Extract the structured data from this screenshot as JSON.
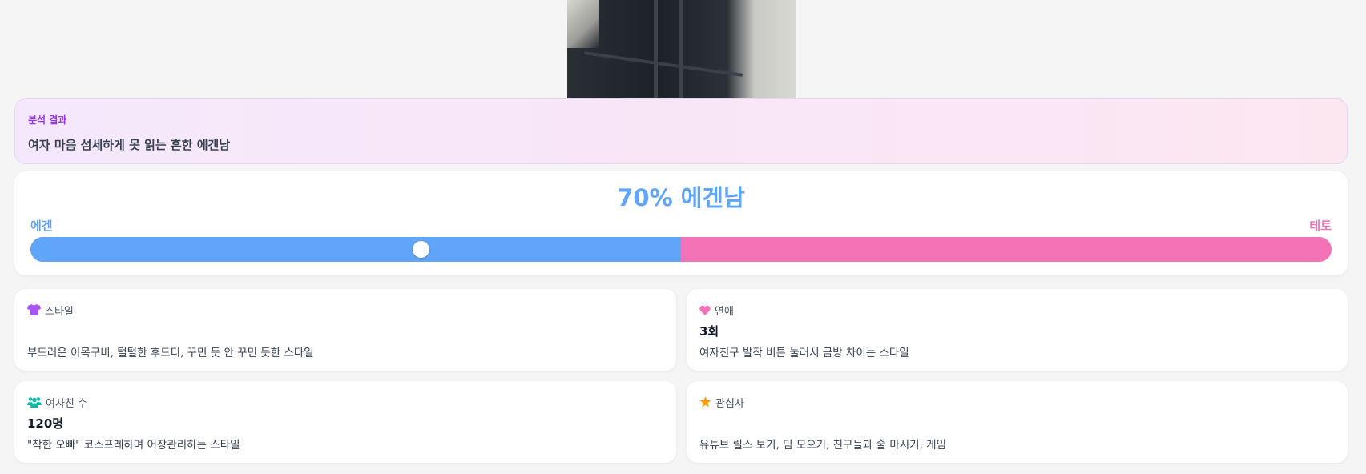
{
  "result": {
    "label": "분석 결과",
    "text": "여자 마음 섬세하게 못 읽는 흔한 에겐남"
  },
  "meter": {
    "headline": "70% 에겐남",
    "left_label": "에겐",
    "right_label": "테토",
    "knob_position_fraction": 0.3,
    "colors": {
      "egen": "#60a5fa",
      "teto": "#f472b6"
    }
  },
  "cards": {
    "style": {
      "icon": "shirt-icon",
      "title": "스타일",
      "value": "",
      "desc": "부드러운 이목구비, 털털한 후드티, 꾸민 듯 안 꾸민 듯한 스타일"
    },
    "dating": {
      "icon": "heart-icon",
      "title": "연애",
      "value": "3회",
      "desc": "여자친구 발작 버튼 눌러서 금방 차이는 스타일"
    },
    "female_friends": {
      "icon": "users-icon",
      "title": "여사친 수",
      "value": "120명",
      "desc": "\"착한 오빠\" 코스프레하며 어장관리하는 스타일"
    },
    "interests": {
      "icon": "star-icon",
      "title": "관심사",
      "value": "",
      "desc": "유튜브 릴스 보기, 밈 모으기, 친구들과 술 마시기, 게임"
    }
  }
}
